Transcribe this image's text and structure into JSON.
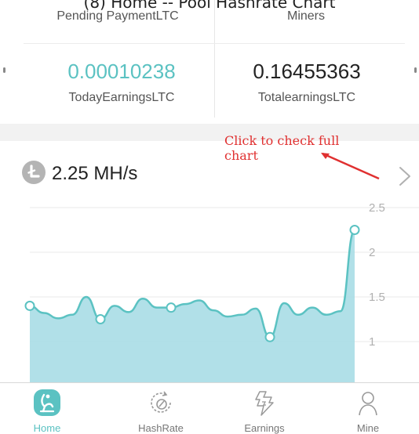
{
  "caption": "(8) Home -- Pool Hashrate Chart",
  "stats": {
    "top_left_label": "Pending PaymentLTC",
    "top_right_label": "Miners",
    "today_earnings_value": "0.00010238",
    "today_earnings_label": "TodayEarningsLTC",
    "total_earnings_value": "0.16455363",
    "total_earnings_label": "TotalearningsLTC"
  },
  "hashrate": {
    "value": "2.25 MH/s",
    "annotation": "Click to check full\nchart"
  },
  "chart_data": {
    "type": "area",
    "y_ticks": [
      "2.5",
      "2",
      "1.5",
      "1"
    ],
    "ylim": [
      0.6,
      2.7
    ],
    "grid": true,
    "values": [
      1.4,
      1.32,
      1.26,
      1.3,
      1.5,
      1.25,
      1.4,
      1.33,
      1.48,
      1.38,
      1.38,
      1.42,
      1.46,
      1.35,
      1.28,
      1.3,
      1.37,
      1.05,
      1.43,
      1.3,
      1.38,
      1.3,
      1.34,
      2.25
    ],
    "marked_points": [
      0,
      5,
      10,
      17,
      23
    ]
  },
  "tabs": [
    {
      "label": "Home",
      "icon": "home-tab-icon",
      "active": true
    },
    {
      "label": "HashRate",
      "icon": "hashrate-tab-icon",
      "active": false
    },
    {
      "label": "Earnings",
      "icon": "earnings-tab-icon",
      "active": false
    },
    {
      "label": "Mine",
      "icon": "user-tab-icon",
      "active": false
    }
  ],
  "colors": {
    "accent": "#5bc2c2",
    "chart_fill": "#a8dde6",
    "annotation": "#e03030"
  }
}
